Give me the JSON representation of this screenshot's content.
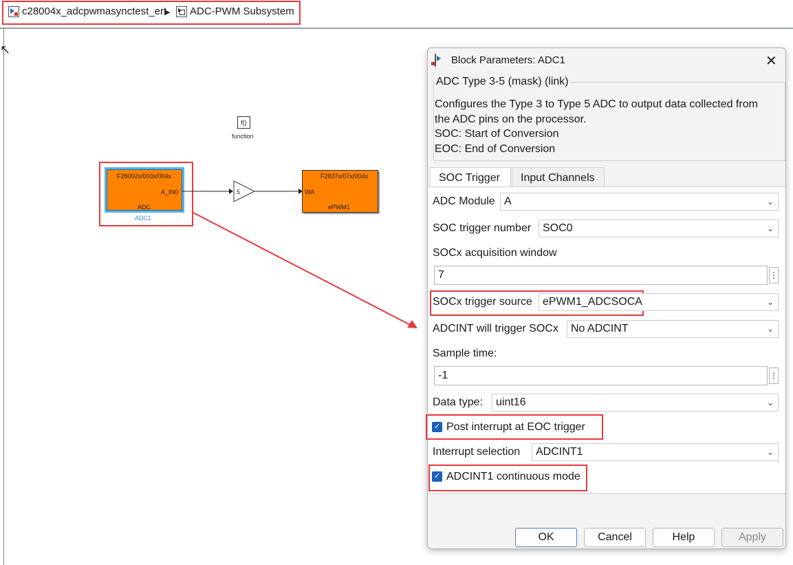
{
  "breadcrumb": {
    "model": "c28004x_adcpwmasynctest_ert",
    "subsystem": "ADC-PWM Subsystem"
  },
  "canvas": {
    "function_icon": "f()",
    "function_label": "function",
    "adc_block": {
      "header": "F28002x/003x/004x",
      "port": "A_IN0",
      "label": "ADC",
      "name": "ADC1"
    },
    "gain_value": "5",
    "epwm_block": {
      "header": "F2837x/07x/004x",
      "port": "WA",
      "label": "ePWM1"
    }
  },
  "dialog": {
    "title": "Block Parameters: ADC1",
    "group_title": "ADC Type 3-5 (mask) (link)",
    "description": [
      "Configures the Type 3 to Type 5 ADC to output data collected from",
      "the ADC pins on the processor.",
      "SOC: Start of Conversion",
      "EOC: End of Conversion"
    ],
    "tabs": [
      "SOC Trigger",
      "Input Channels"
    ],
    "params": {
      "adc_module_label": "ADC Module",
      "adc_module_value": "A",
      "soc_trigger_number_label": "SOC trigger number",
      "soc_trigger_number_value": "SOC0",
      "acq_window_label": "SOCx acquisition window",
      "acq_window_value": "7",
      "trigger_source_label": "SOCx trigger source",
      "trigger_source_value": "ePWM1_ADCSOCA",
      "adcint_trigger_label": "ADCINT will trigger SOCx",
      "adcint_trigger_value": "No ADCINT",
      "sample_time_label": "Sample time:",
      "sample_time_value": "-1",
      "data_type_label": "Data type:",
      "data_type_value": "uint16",
      "post_interrupt_label": "Post interrupt at EOC trigger",
      "interrupt_selection_label": "Interrupt selection",
      "interrupt_selection_value": "ADCINT1",
      "continuous_mode_label": "ADCINT1 continuous mode"
    },
    "buttons": {
      "ok": "OK",
      "cancel": "Cancel",
      "help": "Help",
      "apply": "Apply"
    }
  },
  "colors": {
    "highlight": "#e8383d",
    "block_orange": "#ff8200",
    "checkbox_blue": "#1a62b8"
  }
}
